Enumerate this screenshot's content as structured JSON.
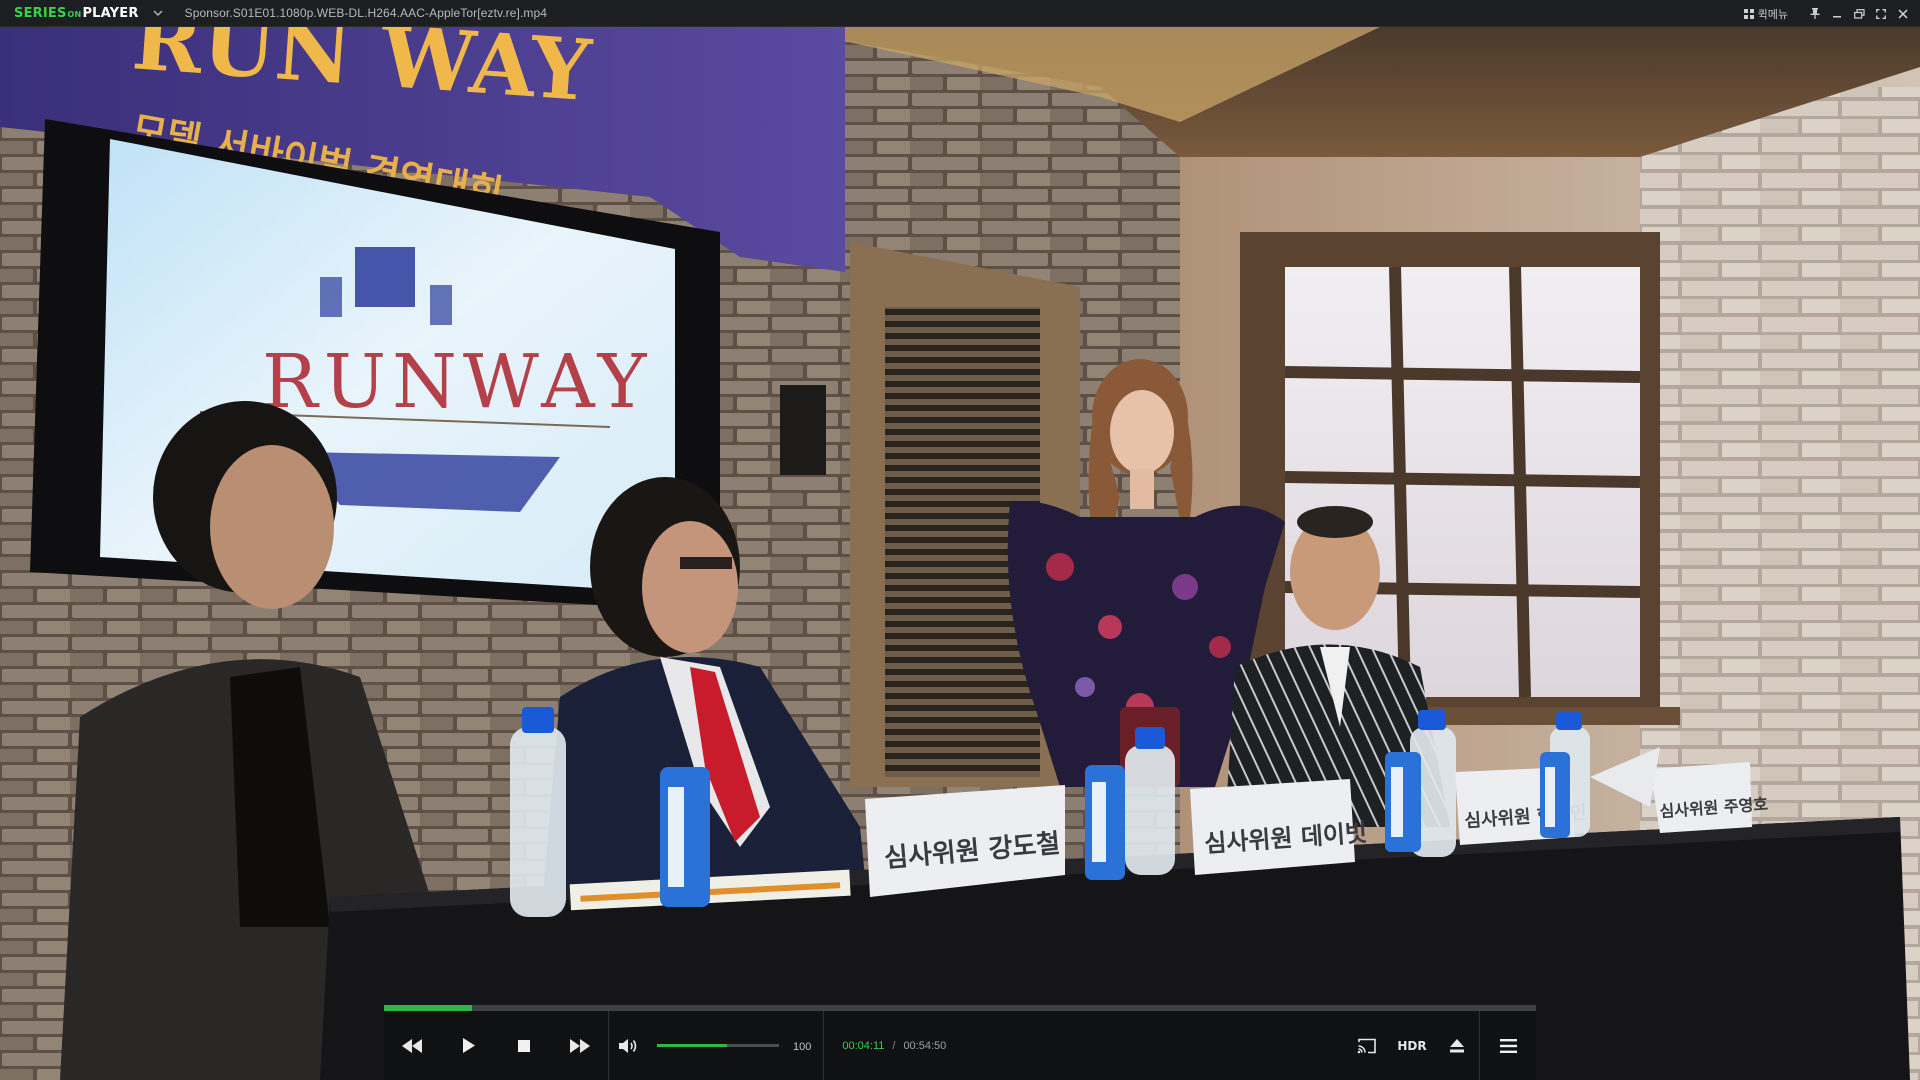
{
  "titlebar": {
    "logo_series": "SERIES",
    "logo_on": "ON",
    "logo_player": "PLAYER",
    "file_name": "Sponsor.S01E01.1080p.WEB-DL.H264.AAC-AppleTor[eztv.re].mp4",
    "quick_menu_label": "퀵메뉴",
    "icons": [
      "logo-dropdown-chevron-icon",
      "quick-menu-grid-icon",
      "pin-icon",
      "minimize-icon",
      "restore-icon",
      "fullscreen-icon",
      "close-icon"
    ]
  },
  "video": {
    "banner_text_1": "RUN WAY",
    "banner_text_2": "모델 서바이벌 경연대회",
    "screen_logo": "RUNWAY",
    "name_cards": [
      "심사위원  강도철",
      "심사위원  데이빗",
      "심사위원  한지민",
      "심사위원  주영호"
    ]
  },
  "player": {
    "progress_fraction": 0.0762,
    "volume_fraction": 0.57,
    "volume_value": "100",
    "current_time": "00:04:11",
    "time_separator": "/",
    "total_time": "00:54:50",
    "hdr_label": "HDR",
    "accent_color": "#35d24a",
    "icons": [
      "rewind-icon",
      "play-icon",
      "stop-icon",
      "fast-forward-icon",
      "volume-icon",
      "cast-icon",
      "eject-icon",
      "menu-icon"
    ]
  }
}
